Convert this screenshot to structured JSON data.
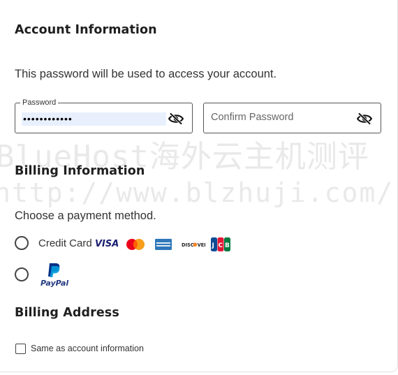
{
  "account": {
    "title": "Account Information",
    "description": "This password will be used to access your account.",
    "password_label": "Password",
    "password_value": "••••••••••••",
    "confirm_placeholder": "Confirm Password"
  },
  "billing": {
    "title": "Billing Information",
    "prompt": "Choose a payment method.",
    "credit_card_label": "Credit Card",
    "card_brands": [
      "VISA",
      "mastercard",
      "AMERICAN EXPRESS",
      "DISCOVER",
      "JCB"
    ],
    "paypal_label": "PayPal"
  },
  "address": {
    "title": "Billing Address",
    "same_as_account_label": "Same as account information"
  },
  "watermark": {
    "line1": "BlueHost海外云主机测评",
    "line2": "http://www.blzhuji.com/"
  },
  "colors": {
    "visa": "#1a1f71",
    "mastercard_red": "#eb001b",
    "mastercard_yellow": "#f79e1b",
    "amex": "#2e77bb",
    "discover_orange": "#f58220",
    "paypal_dark": "#003087",
    "paypal_light": "#009cde"
  }
}
